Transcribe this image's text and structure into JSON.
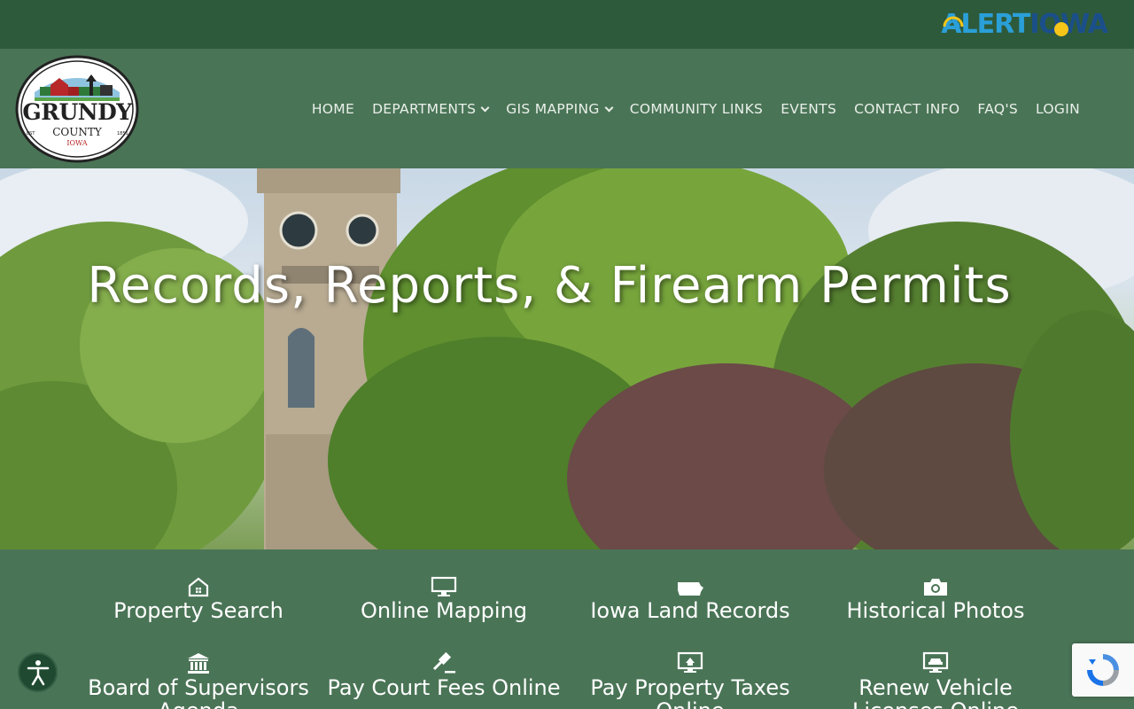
{
  "alert_banner": {
    "part1": "ALERT",
    "part2": "IOWA"
  },
  "county_logo": {
    "name": "GRUNDY",
    "sub": "COUNTY",
    "state": "IOWA",
    "est": "EST",
    "year": "1851"
  },
  "nav": {
    "items": [
      {
        "label": "HOME",
        "dropdown": false
      },
      {
        "label": "DEPARTMENTS",
        "dropdown": true
      },
      {
        "label": "GIS MAPPING",
        "dropdown": true
      },
      {
        "label": "COMMUNITY LINKS",
        "dropdown": false
      },
      {
        "label": "EVENTS",
        "dropdown": false
      },
      {
        "label": "CONTACT INFO",
        "dropdown": false
      },
      {
        "label": "FAQ'S",
        "dropdown": false
      },
      {
        "label": "LOGIN",
        "dropdown": false
      }
    ]
  },
  "hero": {
    "title": "Records, Reports, & Firearm Permits"
  },
  "quick_links": [
    {
      "label": "Property Search",
      "icon": "house-icon"
    },
    {
      "label": "Online Mapping",
      "icon": "monitor-icon"
    },
    {
      "label": "Iowa Land Records",
      "icon": "iowa-state-icon"
    },
    {
      "label": "Historical Photos",
      "icon": "camera-icon"
    },
    {
      "label": "Board of Supervisors Agenda",
      "icon": "courthouse-icon"
    },
    {
      "label": "Pay Court Fees Online",
      "icon": "gavel-icon"
    },
    {
      "label": "Pay Property Taxes Online",
      "icon": "tax-monitor-icon"
    },
    {
      "label": "Renew Vehicle Licenses Online",
      "icon": "car-monitor-icon"
    }
  ],
  "colors": {
    "topbar": "#2e5a3c",
    "header": "#4a7456",
    "accent_blue": "#2a9fd8",
    "accent_yellow": "#f5c518"
  }
}
